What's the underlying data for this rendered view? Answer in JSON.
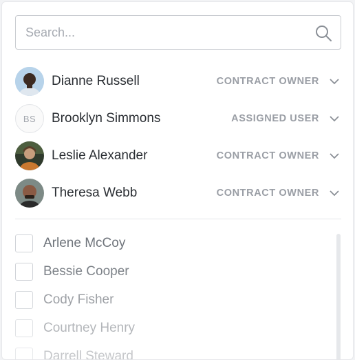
{
  "search": {
    "placeholder": "Search..."
  },
  "assigned_users": [
    {
      "name": "Dianne Russell",
      "role": "CONTRACT OWNER",
      "avatar": "photo"
    },
    {
      "name": "Brooklyn Simmons",
      "role": "ASSIGNED USER",
      "avatar": "initials",
      "initials": "BS"
    },
    {
      "name": "Leslie Alexander",
      "role": "CONTRACT OWNER",
      "avatar": "photo"
    },
    {
      "name": "Theresa Webb",
      "role": "CONTRACT OWNER",
      "avatar": "photo"
    }
  ],
  "candidates": [
    {
      "name": "Arlene McCoy",
      "checked": false
    },
    {
      "name": "Bessie Cooper",
      "checked": false
    },
    {
      "name": "Cody Fisher",
      "checked": false
    },
    {
      "name": "Courtney Henry",
      "checked": false
    },
    {
      "name": "Darrell Steward",
      "checked": false
    }
  ],
  "colors": {
    "role_text": "#9a9ea5",
    "border": "#c9ccd1"
  }
}
